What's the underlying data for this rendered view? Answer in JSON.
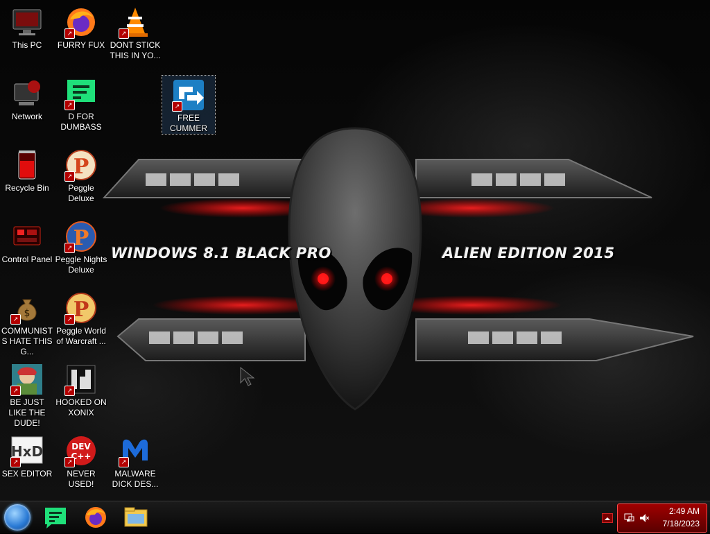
{
  "wallpaper": {
    "left_text": "WINDOWS 8.1 BLACK PRO",
    "right_text": "ALIEN EDITION 2015",
    "accent": "#ff1a1a"
  },
  "desktop_icons": [
    {
      "label": "This PC",
      "icon": "monitor-icon"
    },
    {
      "label": "Network",
      "icon": "network-icon"
    },
    {
      "label": "Recycle Bin",
      "icon": "recycle-bin-icon"
    },
    {
      "label": "Control Panel",
      "icon": "control-panel-icon"
    },
    {
      "label": "COMMUNISTS HATE THIS G...",
      "icon": "money-bag-icon"
    },
    {
      "label": "BE JUST LIKE THE DUDE!",
      "icon": "dude-icon"
    },
    {
      "label": "SEX EDITOR",
      "icon": "hxd-icon"
    },
    {
      "label": "FURRY FUX",
      "icon": "firefox-icon"
    },
    {
      "label": "D FOR DUMBASS",
      "icon": "chat-app-icon"
    },
    {
      "label": "Peggle Deluxe",
      "icon": "peggle-icon"
    },
    {
      "label": "Peggle Nights Deluxe",
      "icon": "peggle-nights-icon"
    },
    {
      "label": "Peggle World of Warcraft ...",
      "icon": "peggle-wow-icon"
    },
    {
      "label": "HOOKED ON XONIX",
      "icon": "xonix-icon"
    },
    {
      "label": "NEVER USED!",
      "icon": "devcpp-icon"
    },
    {
      "label": "DONT STICK THIS IN YO...",
      "icon": "vlc-cone-icon"
    },
    {
      "label": "FREE CUMMER",
      "icon": "converter-icon"
    },
    {
      "label": "MALWARE DICK DES...",
      "icon": "malwarebytes-icon"
    }
  ],
  "taskbar": {
    "pinned": [
      {
        "name": "chat-app",
        "icon": "chat-app-icon"
      },
      {
        "name": "firefox",
        "icon": "firefox-icon"
      },
      {
        "name": "file-explorer",
        "icon": "folder-icon"
      }
    ],
    "clock_time": "2:49 AM",
    "clock_date": "7/18/2023"
  }
}
